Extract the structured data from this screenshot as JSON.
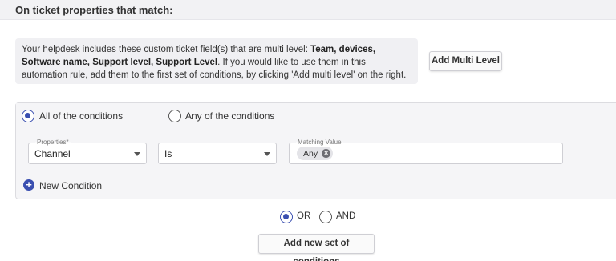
{
  "header": {
    "title": "On ticket properties that match:"
  },
  "info": {
    "text_before": "Your helpdesk includes these custom ticket field(s) that are multi level: ",
    "fields_bold": "Team, devices, Software name, Support level, Support Level",
    "text_after": ". If you would like to use them in this automation rule, add them to the first set of conditions, by clicking 'Add multi level' on the right."
  },
  "buttons": {
    "add_multi_level": "Add Multi Level",
    "add_new_set": "Add new set of conditions"
  },
  "match_mode": {
    "all_label": "All of the conditions",
    "any_label": "Any of the conditions",
    "selected": "all"
  },
  "condition": {
    "property_label": "Properties*",
    "property_value": "Channel",
    "operator_value": "Is",
    "matching_label": "Matching Value",
    "matching_chip": "Any"
  },
  "new_condition_label": "New Condition",
  "set_join": {
    "or_label": "OR",
    "and_label": "AND",
    "selected": "or"
  },
  "colors": {
    "accent": "#3a4fb0",
    "panel_bg": "#f5f5f7",
    "header_bg": "#f2f2f4"
  },
  "icons": {
    "remove_chip": "close-circle-icon",
    "add_condition": "plus-circle-icon",
    "dropdown": "caret-down-icon"
  }
}
